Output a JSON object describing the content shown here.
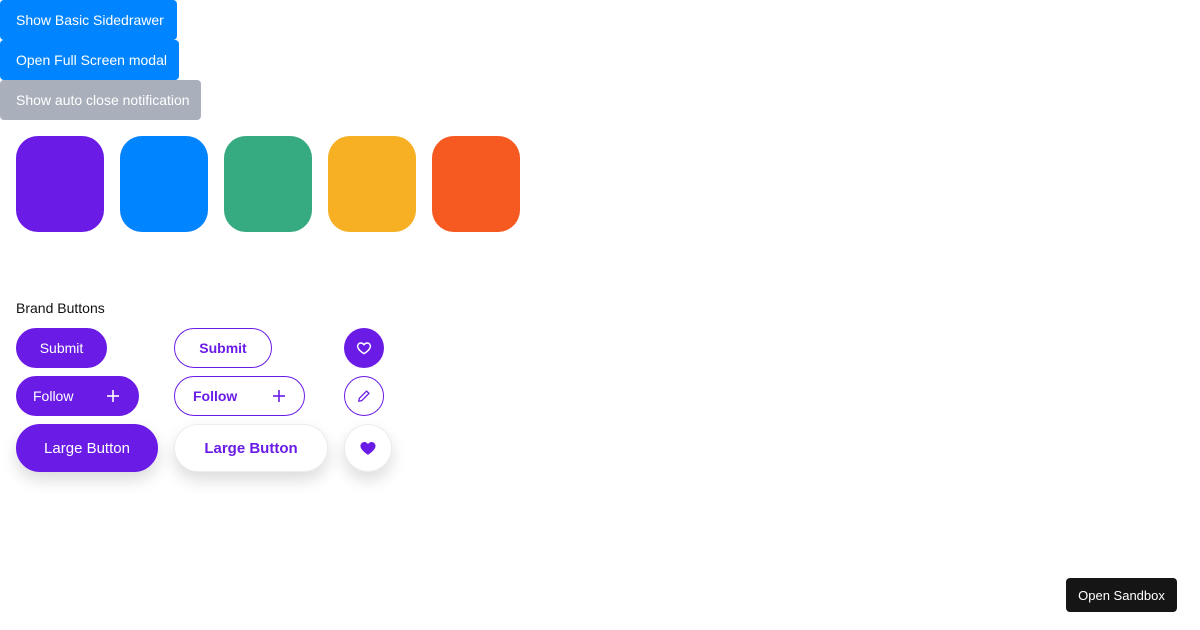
{
  "top_buttons": {
    "sidedrawer_label": "Show Basic Sidedrawer",
    "fullscreen_modal_label": "Open Full Screen modal",
    "notification_label": "Show auto close notification"
  },
  "swatches": {
    "colors": [
      "#6a1be6",
      "#0084ff",
      "#36aa80",
      "#f7b024",
      "#f65a21"
    ]
  },
  "brand_buttons": {
    "section_title": "Brand Buttons",
    "submit_label": "Submit",
    "follow_label": "Follow",
    "large_button_label": "Large Button",
    "brand_color": "#6a1be6",
    "icons": {
      "heart_outline": "heart-outline-icon",
      "pencil": "pencil-icon",
      "heart_filled": "heart-filled-icon",
      "plus": "plus-icon"
    }
  },
  "sandbox": {
    "label": "Open Sandbox"
  }
}
